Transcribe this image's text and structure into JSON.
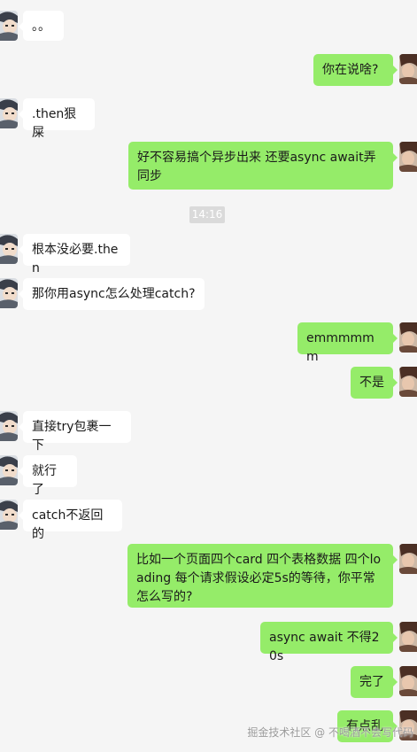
{
  "chat": {
    "timestamp": "14:16",
    "messages": [
      {
        "side": "in",
        "text": "。。"
      },
      {
        "side": "out",
        "text": "你在说啥?"
      },
      {
        "side": "in",
        "text": ".then狠屎"
      },
      {
        "side": "out",
        "text": "好不容易搞个异步出来 还要async await弄同步"
      },
      {
        "side": "in",
        "text": "根本没必要.then"
      },
      {
        "side": "in",
        "text": "那你用async怎么处理catch?"
      },
      {
        "side": "out",
        "text": "emmmmmm"
      },
      {
        "side": "out",
        "text": "不是"
      },
      {
        "side": "in",
        "text": "直接try包裹一下"
      },
      {
        "side": "in",
        "text": "就行了"
      },
      {
        "side": "in",
        "text": "catch不返回的"
      },
      {
        "side": "out",
        "text": "比如一个页面四个card 四个表格数据 四个loading 每个请求假设必定5s的等待，你平常怎么写的?"
      },
      {
        "side": "out",
        "text": "async await 不得20s"
      },
      {
        "side": "out",
        "text": "完了"
      },
      {
        "side": "out",
        "text": "有点乱"
      }
    ]
  },
  "watermark": "掘金技术社区 @ 不喝酒不会写代码"
}
